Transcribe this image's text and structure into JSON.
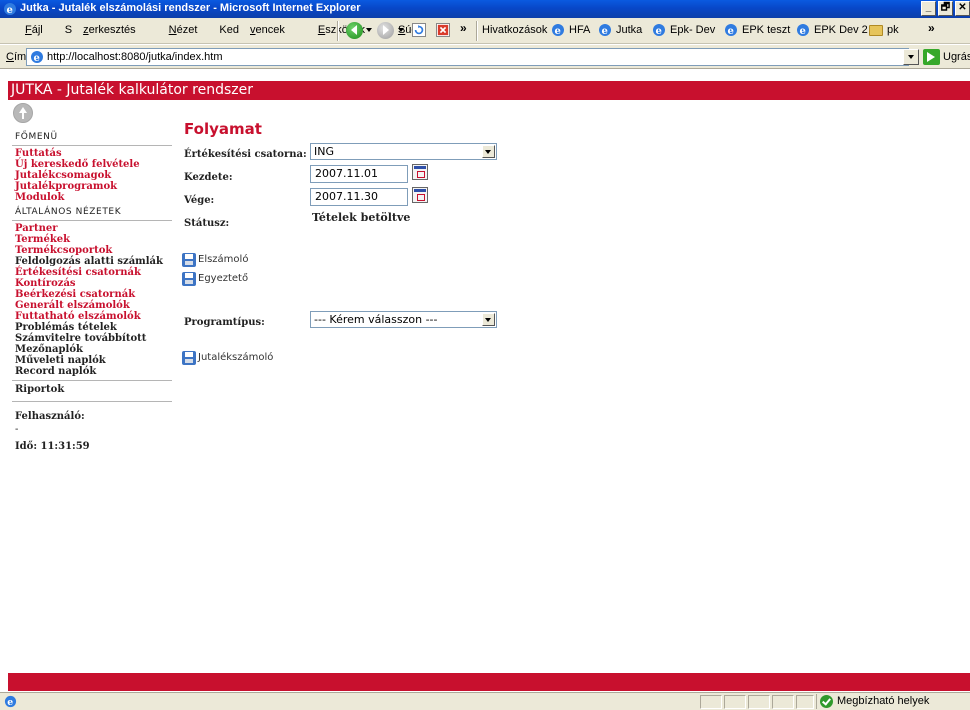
{
  "window": {
    "title": "Jutka - Jutalék elszámolási rendszer - Microsoft Internet Explorer",
    "buttons": [
      "_",
      "🗗",
      "✕"
    ]
  },
  "menubar": {
    "items": [
      {
        "pre": "",
        "key": "F",
        "post": "ájl"
      },
      {
        "pre": "S",
        "key": "z",
        "post": "erkesztés"
      },
      {
        "pre": "",
        "key": "N",
        "post": "ézet"
      },
      {
        "pre": "Ked",
        "key": "v",
        "post": "encek"
      },
      {
        "pre": "",
        "key": "E",
        "post": "szközök"
      },
      {
        "pre": "",
        "key": "S",
        "post": "úgó"
      }
    ],
    "chevron": "»"
  },
  "links": {
    "label": "Hivatkozások",
    "chevron": "»",
    "items": [
      "HFA",
      "Jutka",
      "Epk- Dev",
      "EPK teszt",
      "EPK Dev 2",
      "pk"
    ]
  },
  "address": {
    "label_pre": "",
    "label_key": "C",
    "label_post": "ím",
    "url": "http://localhost:8080/jutka/index.htm",
    "go_label": "Ugrás"
  },
  "app": {
    "title": "JUTKA - Jutalék kalkulátor rendszer"
  },
  "sidebar": {
    "main_menu_title": "FŐMENÜ",
    "main_menu": [
      {
        "label": "Futtatás",
        "link": true
      },
      {
        "label": "Új kereskedő felvétele",
        "link": true
      },
      {
        "label": "Jutalékcsomagok",
        "link": true
      },
      {
        "label": "Jutalékprogramok",
        "link": true
      },
      {
        "label": "Modulok",
        "link": true
      }
    ],
    "views_title": "ÁLTALÁNOS NÉZETEK",
    "views": [
      {
        "label": "Partner",
        "link": true
      },
      {
        "label": "Termékek",
        "link": true
      },
      {
        "label": "Termékcsoportok",
        "link": true
      },
      {
        "label": "Feldolgozás alatti számlák",
        "link": false
      },
      {
        "label": "Értékesítési csatornák",
        "link": true
      },
      {
        "label": "Kontírozás",
        "link": true
      },
      {
        "label": "Beérkezési csatornák",
        "link": true
      },
      {
        "label": "Generált elszámolók",
        "link": true
      },
      {
        "label": "Futtatható elszámolók",
        "link": true
      },
      {
        "label": "Problémás tételek",
        "link": false
      },
      {
        "label": "Számvitelre továbbított",
        "link": false
      },
      {
        "label": "Mezőnaplók",
        "link": false
      },
      {
        "label": "Műveleti naplók",
        "link": false
      },
      {
        "label": "Record naplók",
        "link": false
      }
    ],
    "reports": "Riportok",
    "user_label": "Felhasználó:",
    "user_value": "-",
    "time_label": "Idő: 11:31:59"
  },
  "main": {
    "title": "Folyamat",
    "channel_label": "Értékesítési csatorna:",
    "channel_value": "ING",
    "start_label": "Kezdete:",
    "start_value": "2007.11.01",
    "end_label": "Vége:",
    "end_value": "2007.11.30",
    "status_label": "Státusz:",
    "status_value": "Tételek betöltve",
    "action_settlement": "Elszámoló",
    "action_reconcile": "Egyeztető",
    "program_type_label": "Programtípus:",
    "program_type_value": "--- Kérem válasszon ---",
    "action_commission": "Jutalékszámoló"
  },
  "statusbar": {
    "zone": "Megbízható helyek"
  },
  "colors": {
    "brand_red": "#c8102e",
    "xp_blue": "#0847c8",
    "chrome": "#ece9d8"
  },
  "icons": [
    "ie-icon",
    "back-icon",
    "forward-icon",
    "stop-icon",
    "refresh-icon",
    "page-icon",
    "folder-icon",
    "go-arrow-icon",
    "up-arrow-icon",
    "calendar-icon",
    "save-icon",
    "trusted-zone-icon"
  ]
}
